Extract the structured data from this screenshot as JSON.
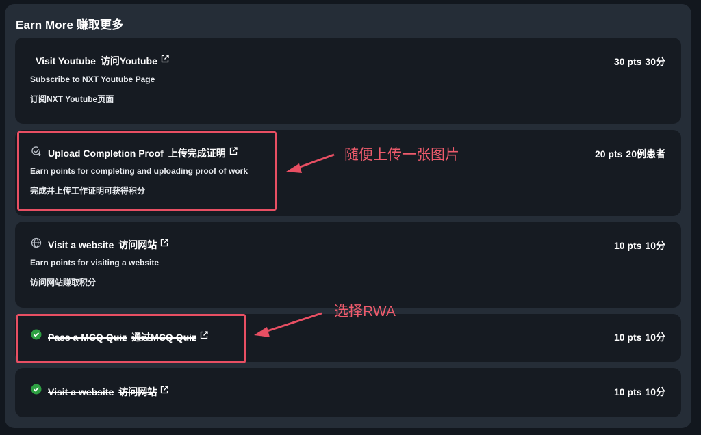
{
  "section": {
    "title": "Earn More  赚取更多"
  },
  "tasks": [
    {
      "title_en": "Visit Youtube",
      "title_zh": "访问Youtube",
      "desc_en": "Subscribe to NXT Youtube Page",
      "desc_zh": "订阅NXT Youtube页面",
      "points_en": "30 pts",
      "points_zh": "30分",
      "icon": "none",
      "completed": false
    },
    {
      "title_en": "Upload Completion Proof",
      "title_zh": "上传完成证明",
      "desc_en": "Earn points for completing and uploading proof of work",
      "desc_zh": "完成并上传工作证明可获得积分",
      "points_en": "20 pts",
      "points_zh": "20例患者",
      "icon": "upload-check-icon",
      "completed": false
    },
    {
      "title_en": "Visit a website",
      "title_zh": "访问网站",
      "desc_en": "Earn points for visiting a website",
      "desc_zh": "访问网站赚取积分",
      "points_en": "10 pts",
      "points_zh": "10分",
      "icon": "globe-icon",
      "completed": false
    },
    {
      "title_en": "Pass a MCQ Quiz",
      "title_zh": "通过MCQ Quiz",
      "points_en": "10 pts",
      "points_zh": "10分",
      "icon": "check-circle-icon",
      "completed": true
    },
    {
      "title_en": "Visit a website",
      "title_zh": "访问网站",
      "points_en": "10 pts",
      "points_zh": "10分",
      "icon": "check-circle-icon",
      "completed": true
    }
  ],
  "annotations": {
    "upload_note": "随便上传一张图片",
    "quiz_note": "选择RWA",
    "color": "#e84f63"
  },
  "colors": {
    "background": "#12171e",
    "panel": "#252d37",
    "card": "#161b22",
    "success": "#2ea043"
  }
}
